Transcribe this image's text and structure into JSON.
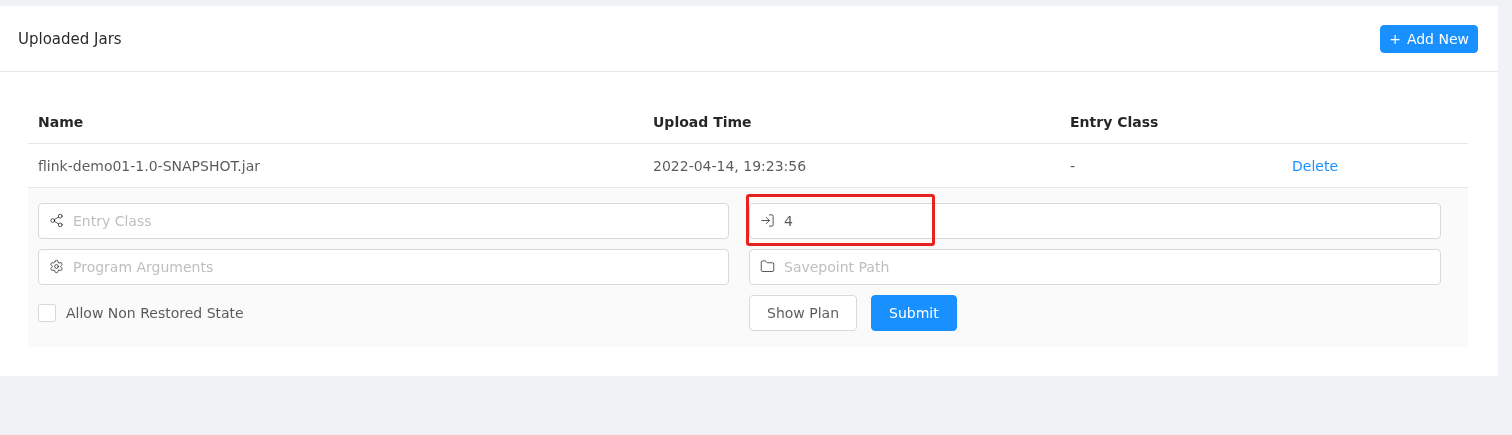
{
  "card": {
    "title": "Uploaded Jars",
    "add_button": {
      "icon": "+",
      "label": "Add New"
    }
  },
  "table": {
    "columns": [
      "Name",
      "Upload Time",
      "Entry Class"
    ],
    "rows": [
      {
        "name": "flink-demo01-1.0-SNAPSHOT.jar",
        "upload_time": "2022-04-14, 19:23:56",
        "entry_class": "-",
        "action": "Delete",
        "expanded": true
      }
    ]
  },
  "submit_form": {
    "fields": [
      {
        "kind": "entry",
        "placeholder": "Entry Class",
        "highlighted": false
      },
      {
        "kind": "parallelism",
        "value": "4",
        "highlighted": true
      },
      {
        "kind": "args",
        "placeholder": "Program Arguments",
        "highlighted": false
      },
      {
        "kind": "savepoint",
        "placeholder": "Savepoint Path",
        "highlighted": false
      }
    ],
    "allow_non_restored": {
      "label": "Allow Non Restored State",
      "checked": false
    },
    "buttons": [
      {
        "label": "Show Plan",
        "kind": "default"
      },
      {
        "label": "Submit",
        "kind": "primary"
      }
    ]
  }
}
